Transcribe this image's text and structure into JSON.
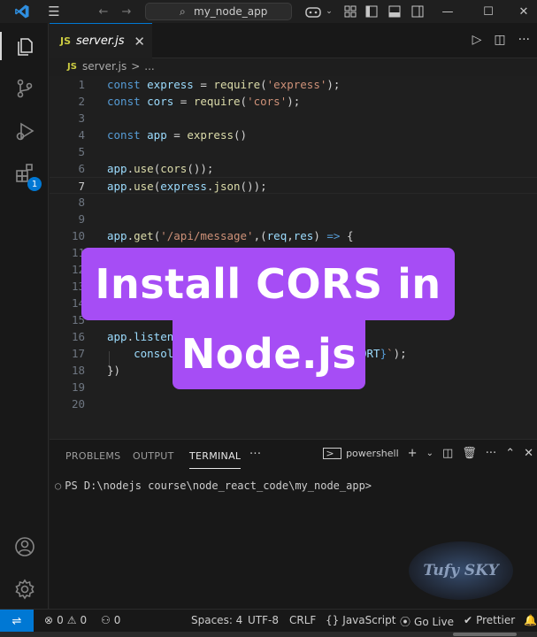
{
  "titlebar": {
    "search_text": "my_node_app"
  },
  "tab": {
    "lang": "JS",
    "filename": "server.js",
    "close": "✕"
  },
  "breadcrumb": {
    "lang": "JS",
    "file": "server.js",
    "sep": ">",
    "more": "..."
  },
  "activity": {
    "extensions_badge": "1"
  },
  "code": {
    "line_numbers": [
      "1",
      "2",
      "3",
      "4",
      "5",
      "6",
      "7",
      "8",
      "9",
      "10",
      "11",
      "12",
      "13",
      "14",
      "15",
      "16",
      "17",
      "18",
      "19",
      "20"
    ],
    "current_line": "7"
  },
  "overlay": {
    "line1": "Install CORS in",
    "line2": "Node.js"
  },
  "panel": {
    "tabs": [
      "PROBLEMS",
      "OUTPUT",
      "TERMINAL"
    ],
    "active_tab": "TERMINAL",
    "more": "···",
    "shell_name": "powershell",
    "terminal_prompt": "PS D:\\nodejs course\\node_react_code\\my_node_app>"
  },
  "watermark": {
    "text": "Tufy SKY"
  },
  "statusbar": {
    "errors": "0",
    "warnings": "0",
    "ports": "0",
    "spaces": "Spaces: 4",
    "encoding": "UTF-8",
    "eol": "CRLF",
    "language": "JavaScript",
    "golive": "Go Live",
    "prettier": "Prettier"
  },
  "colors": {
    "accent": "#0078d4",
    "overlay": "#a64df5",
    "keyword": "#569cd6",
    "string": "#ce9178",
    "function": "#dcdcaa",
    "variable": "#9cdcfe"
  }
}
